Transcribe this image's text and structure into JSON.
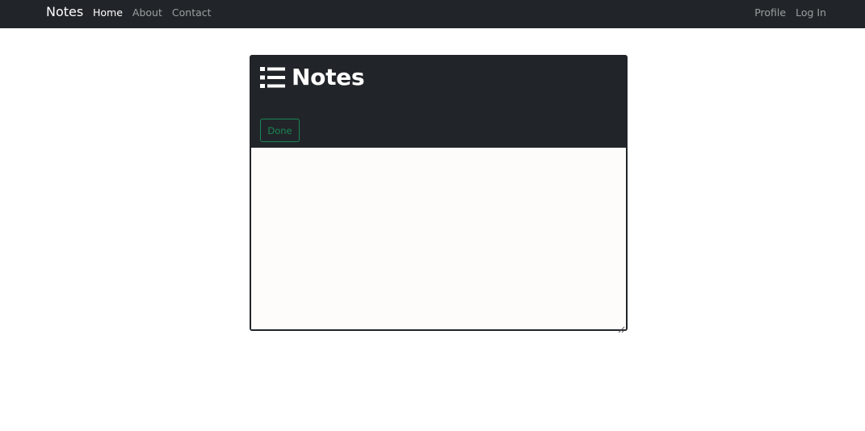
{
  "navbar": {
    "brand": "Notes",
    "links": [
      {
        "label": "Home",
        "active": true
      },
      {
        "label": "About",
        "active": false
      },
      {
        "label": "Contact",
        "active": false
      }
    ],
    "right_links": [
      {
        "label": "Profile"
      },
      {
        "label": "Log In"
      }
    ]
  },
  "card": {
    "title": "Notes",
    "title_icon": "list-icon",
    "back_icon": "arrow-left-icon",
    "done_label": "Done",
    "note_value": ""
  },
  "colors": {
    "navbar_bg": "#212529",
    "card_bg": "#212529",
    "done_accent": "#198754",
    "textarea_bg": "#fdfcfa"
  }
}
